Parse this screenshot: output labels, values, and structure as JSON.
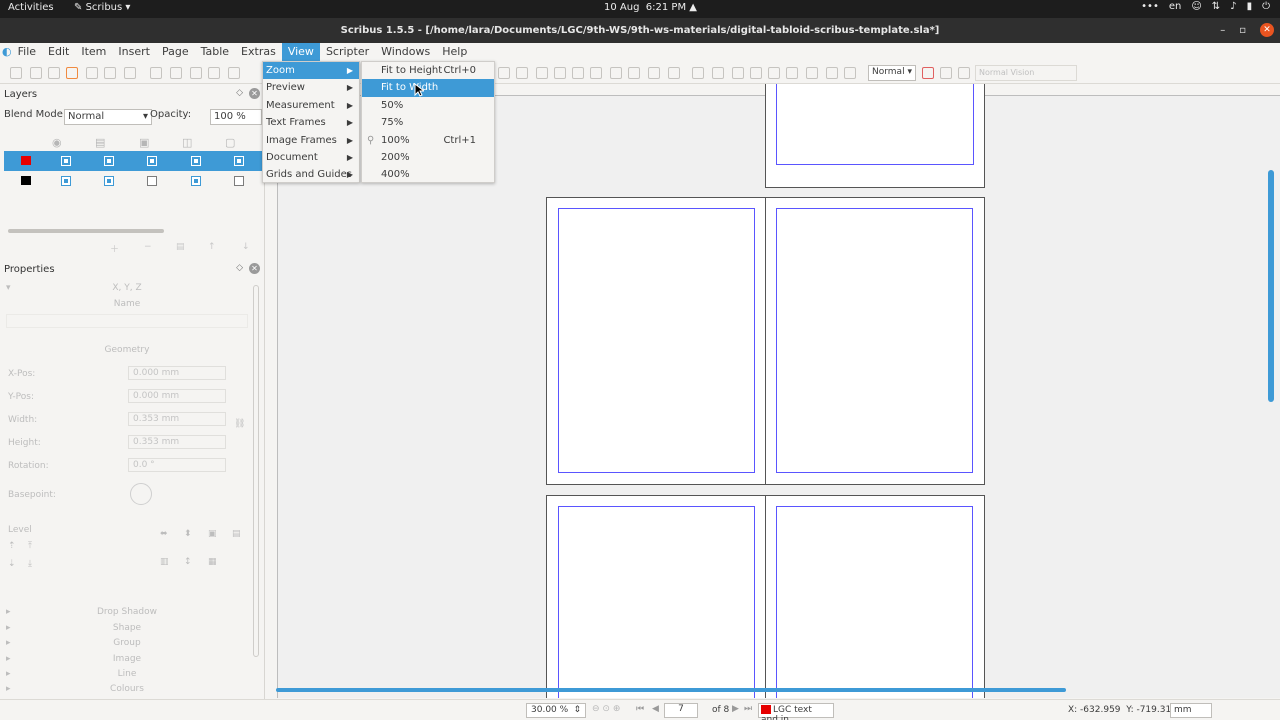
{
  "os_topbar": {
    "activities": "Activities",
    "app_menu": "Scribus",
    "clock_date": "10 Aug",
    "clock_time": "6:21 PM",
    "language": "en"
  },
  "window": {
    "title": "Scribus 1.5.5 - [/home/lara/Documents/LGC/9th-WS/9th-ws-materials/digital-tabloid-scribus-template.sla*]"
  },
  "menubar": [
    "File",
    "Edit",
    "Item",
    "Insert",
    "Page",
    "Table",
    "Extras",
    "View",
    "Scripter",
    "Windows",
    "Help"
  ],
  "toolbar": {
    "mode_value": "Normal",
    "vision_value": "Normal Vision"
  },
  "layers": {
    "title": "Layers",
    "blend_label": "Blend Mode:",
    "blend_value": "Normal",
    "opacity_label": "Opacity:",
    "opacity_value": "100 %",
    "rows": [
      {
        "color": "#e60000",
        "selected": true
      },
      {
        "color": "#000000",
        "selected": false
      }
    ]
  },
  "properties": {
    "title": "Properties",
    "xyz": "X, Y, Z",
    "name_label": "Name",
    "geometry": "Geometry",
    "xpos_label": "X-Pos:",
    "xpos_value": "0.000 mm",
    "ypos_label": "Y-Pos:",
    "ypos_value": "0.000 mm",
    "width_label": "Width:",
    "width_value": "0.353 mm",
    "height_label": "Height:",
    "height_value": "0.353 mm",
    "rotation_label": "Rotation:",
    "rotation_value": "0.0 °",
    "basepoint_label": "Basepoint:",
    "level_label": "Level",
    "sections": [
      "Drop Shadow",
      "Shape",
      "Group",
      "Image",
      "Line",
      "Colours"
    ]
  },
  "view_menu": {
    "items": [
      "Zoom",
      "Preview",
      "Measurement",
      "Text Frames",
      "Image Frames",
      "Document",
      "Grids and Guides"
    ],
    "highlighted_index": 0
  },
  "zoom_menu": {
    "items": [
      {
        "label": "Fit to Height",
        "shortcut": "Ctrl+0"
      },
      {
        "label": "Fit to Width",
        "shortcut": ""
      },
      {
        "label": "50%",
        "shortcut": ""
      },
      {
        "label": "75%",
        "shortcut": ""
      },
      {
        "label": "100%",
        "shortcut": "Ctrl+1"
      },
      {
        "label": "200%",
        "shortcut": ""
      },
      {
        "label": "400%",
        "shortcut": ""
      }
    ],
    "highlighted_index": 1
  },
  "statusbar": {
    "zoom_value": "30.00 %",
    "page_value": "7",
    "page_of": "of 8",
    "layer_value": "LGC text and in",
    "x_coord": "X: -632.959",
    "y_coord": "Y: -719.313",
    "unit": "mm"
  }
}
